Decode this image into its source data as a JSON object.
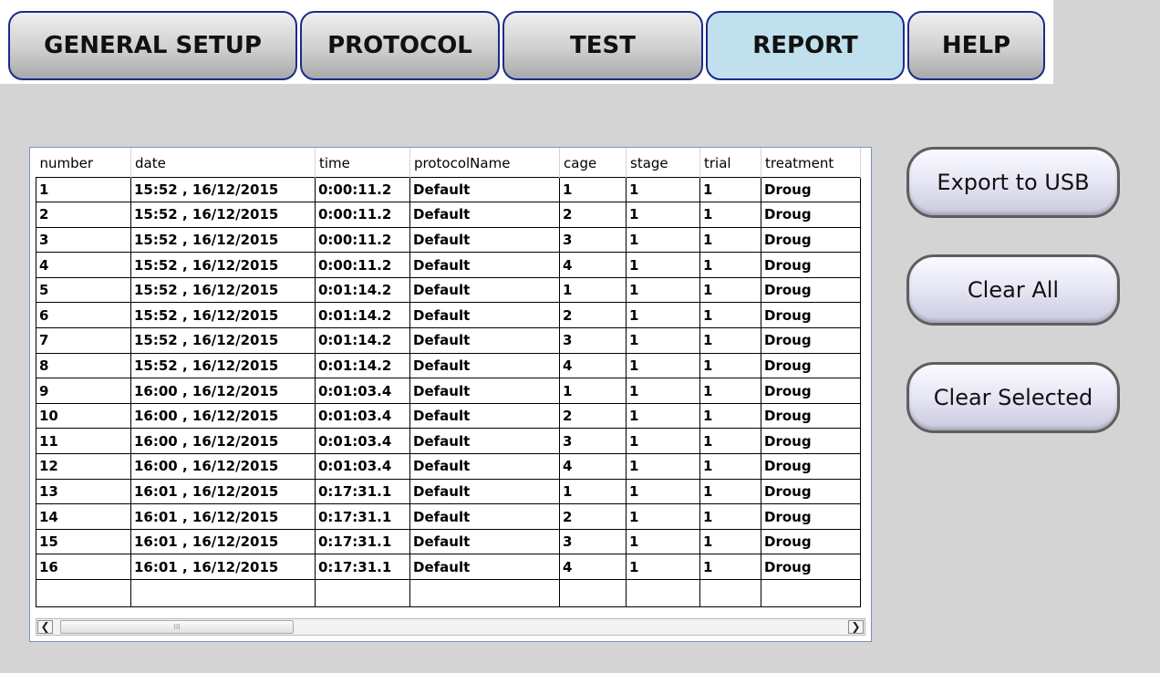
{
  "tabs": [
    {
      "label": "GENERAL SETUP",
      "active": false
    },
    {
      "label": "PROTOCOL",
      "active": false
    },
    {
      "label": "TEST",
      "active": false
    },
    {
      "label": "REPORT",
      "active": true
    },
    {
      "label": "HELP",
      "active": false
    }
  ],
  "table": {
    "columns": [
      "number",
      "date",
      "time",
      "protocolName",
      "cage",
      "stage",
      "trial",
      "treatment"
    ],
    "rows": [
      [
        "1",
        "15:52 , 16/12/2015",
        "0:00:11.2",
        "Default",
        "1",
        "1",
        "1",
        "Droug"
      ],
      [
        "2",
        "15:52 , 16/12/2015",
        "0:00:11.2",
        "Default",
        "2",
        "1",
        "1",
        "Droug"
      ],
      [
        "3",
        "15:52 , 16/12/2015",
        "0:00:11.2",
        "Default",
        "3",
        "1",
        "1",
        "Droug"
      ],
      [
        "4",
        "15:52 , 16/12/2015",
        "0:00:11.2",
        "Default",
        "4",
        "1",
        "1",
        "Droug"
      ],
      [
        "5",
        "15:52 , 16/12/2015",
        "0:01:14.2",
        "Default",
        "1",
        "1",
        "1",
        "Droug"
      ],
      [
        "6",
        "15:52 , 16/12/2015",
        "0:01:14.2",
        "Default",
        "2",
        "1",
        "1",
        "Droug"
      ],
      [
        "7",
        "15:52 , 16/12/2015",
        "0:01:14.2",
        "Default",
        "3",
        "1",
        "1",
        "Droug"
      ],
      [
        "8",
        "15:52 , 16/12/2015",
        "0:01:14.2",
        "Default",
        "4",
        "1",
        "1",
        "Droug"
      ],
      [
        "9",
        "16:00 , 16/12/2015",
        "0:01:03.4",
        "Default",
        "1",
        "1",
        "1",
        "Droug"
      ],
      [
        "10",
        "16:00 , 16/12/2015",
        "0:01:03.4",
        "Default",
        "2",
        "1",
        "1",
        "Droug"
      ],
      [
        "11",
        "16:00 , 16/12/2015",
        "0:01:03.4",
        "Default",
        "3",
        "1",
        "1",
        "Droug"
      ],
      [
        "12",
        "16:00 , 16/12/2015",
        "0:01:03.4",
        "Default",
        "4",
        "1",
        "1",
        "Droug"
      ],
      [
        "13",
        "16:01 , 16/12/2015",
        "0:17:31.1",
        "Default",
        "1",
        "1",
        "1",
        "Droug"
      ],
      [
        "14",
        "16:01 , 16/12/2015",
        "0:17:31.1",
        "Default",
        "2",
        "1",
        "1",
        "Droug"
      ],
      [
        "15",
        "16:01 , 16/12/2015",
        "0:17:31.1",
        "Default",
        "3",
        "1",
        "1",
        "Droug"
      ],
      [
        "16",
        "16:01 , 16/12/2015",
        "0:17:31.1",
        "Default",
        "4",
        "1",
        "1",
        "Droug"
      ]
    ]
  },
  "scrollbar": {
    "left_icon": "arrow-left-icon",
    "right_icon": "arrow-right-icon",
    "grip": "III"
  },
  "actions": {
    "export_label": "Export to USB",
    "clear_all_label": "Clear All",
    "clear_selected_label": "Clear Selected"
  },
  "colors": {
    "tab_border": "#1c2a8c",
    "active_tab": "#bfe0ec",
    "background": "#d4d4d4"
  }
}
